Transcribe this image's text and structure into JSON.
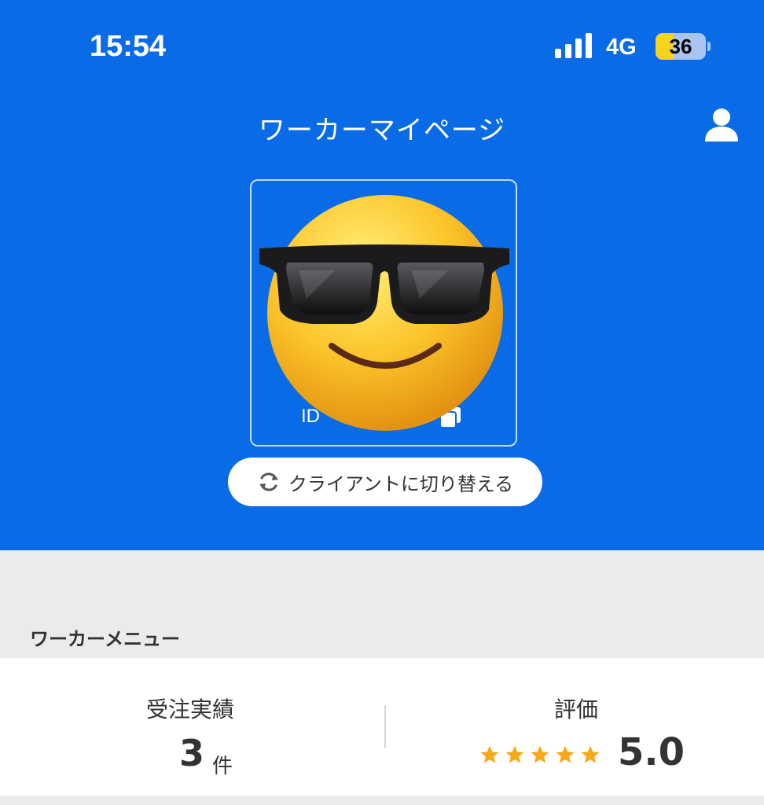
{
  "status_bar": {
    "time": "15:54",
    "network": "4G",
    "battery": "36",
    "battery_fraction": 0.36
  },
  "header": {
    "title": "ワーカーマイページ",
    "profile_icon": "person-icon"
  },
  "profile": {
    "avatar": "smiling-face-with-sunglasses-emoji",
    "id_label": "ID",
    "copy_icon": "copy-icon"
  },
  "switch_button": {
    "label": "クライアントに切り替える",
    "icon": "refresh-icon"
  },
  "menu": {
    "section_title": "ワーカーメニュー"
  },
  "stats": {
    "orders_label": "受注実績",
    "orders_count": "3",
    "orders_unit": "件",
    "rating_label": "評価",
    "rating_value": "5.0",
    "stars": 5
  },
  "colors": {
    "brand_blue": "#0a6be6",
    "star": "#f7a91b"
  }
}
